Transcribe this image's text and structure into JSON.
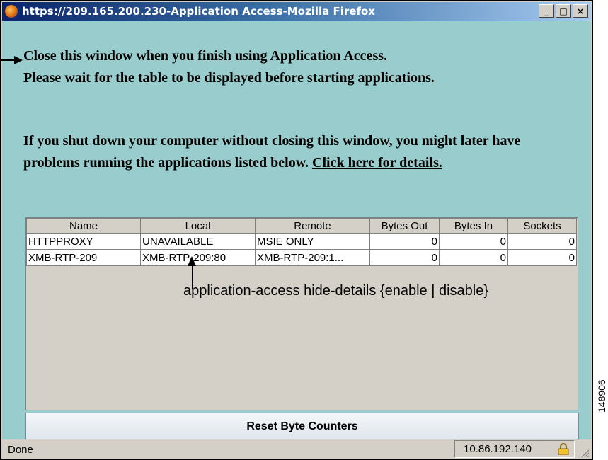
{
  "window": {
    "title": "https://209.165.200.230-Application Access-Mozilla Firefox",
    "controls": {
      "minimize": "_",
      "maximize": "□",
      "close": "×"
    }
  },
  "messages": {
    "line1": "Close this window when you finish using Application Access.",
    "line2": "Please wait for the table to be displayed before starting applications.",
    "warning_text": "If you shut down your computer without closing this window, you might later have problems running the applications listed below.",
    "details_link": "Click here for details."
  },
  "table": {
    "headers": [
      "Name",
      "Local",
      "Remote",
      "Bytes Out",
      "Bytes In",
      "Sockets"
    ],
    "rows": [
      [
        "HTTPPROXY",
        "UNAVAILABLE",
        "MSIE ONLY",
        "0",
        "0",
        "0"
      ],
      [
        "XMB-RTP-209",
        "XMB-RTP-209:80",
        "XMB-RTP-209:1...",
        "0",
        "0",
        "0"
      ]
    ]
  },
  "annotation": "application-access hide-details {enable | disable}",
  "reset_button": {
    "label": "Reset Byte Counters"
  },
  "status": {
    "left": "Done",
    "ip": "10.86.192.140"
  },
  "figure_id": "148906",
  "colors": {
    "content_background": "#99cccc",
    "titlebar_start": "#0a246a",
    "titlebar_end": "#a6caf0"
  },
  "icons": [
    "firefox-icon",
    "lock-icon",
    "resize-grip-icon",
    "arrow-left",
    "arrow-up"
  ]
}
